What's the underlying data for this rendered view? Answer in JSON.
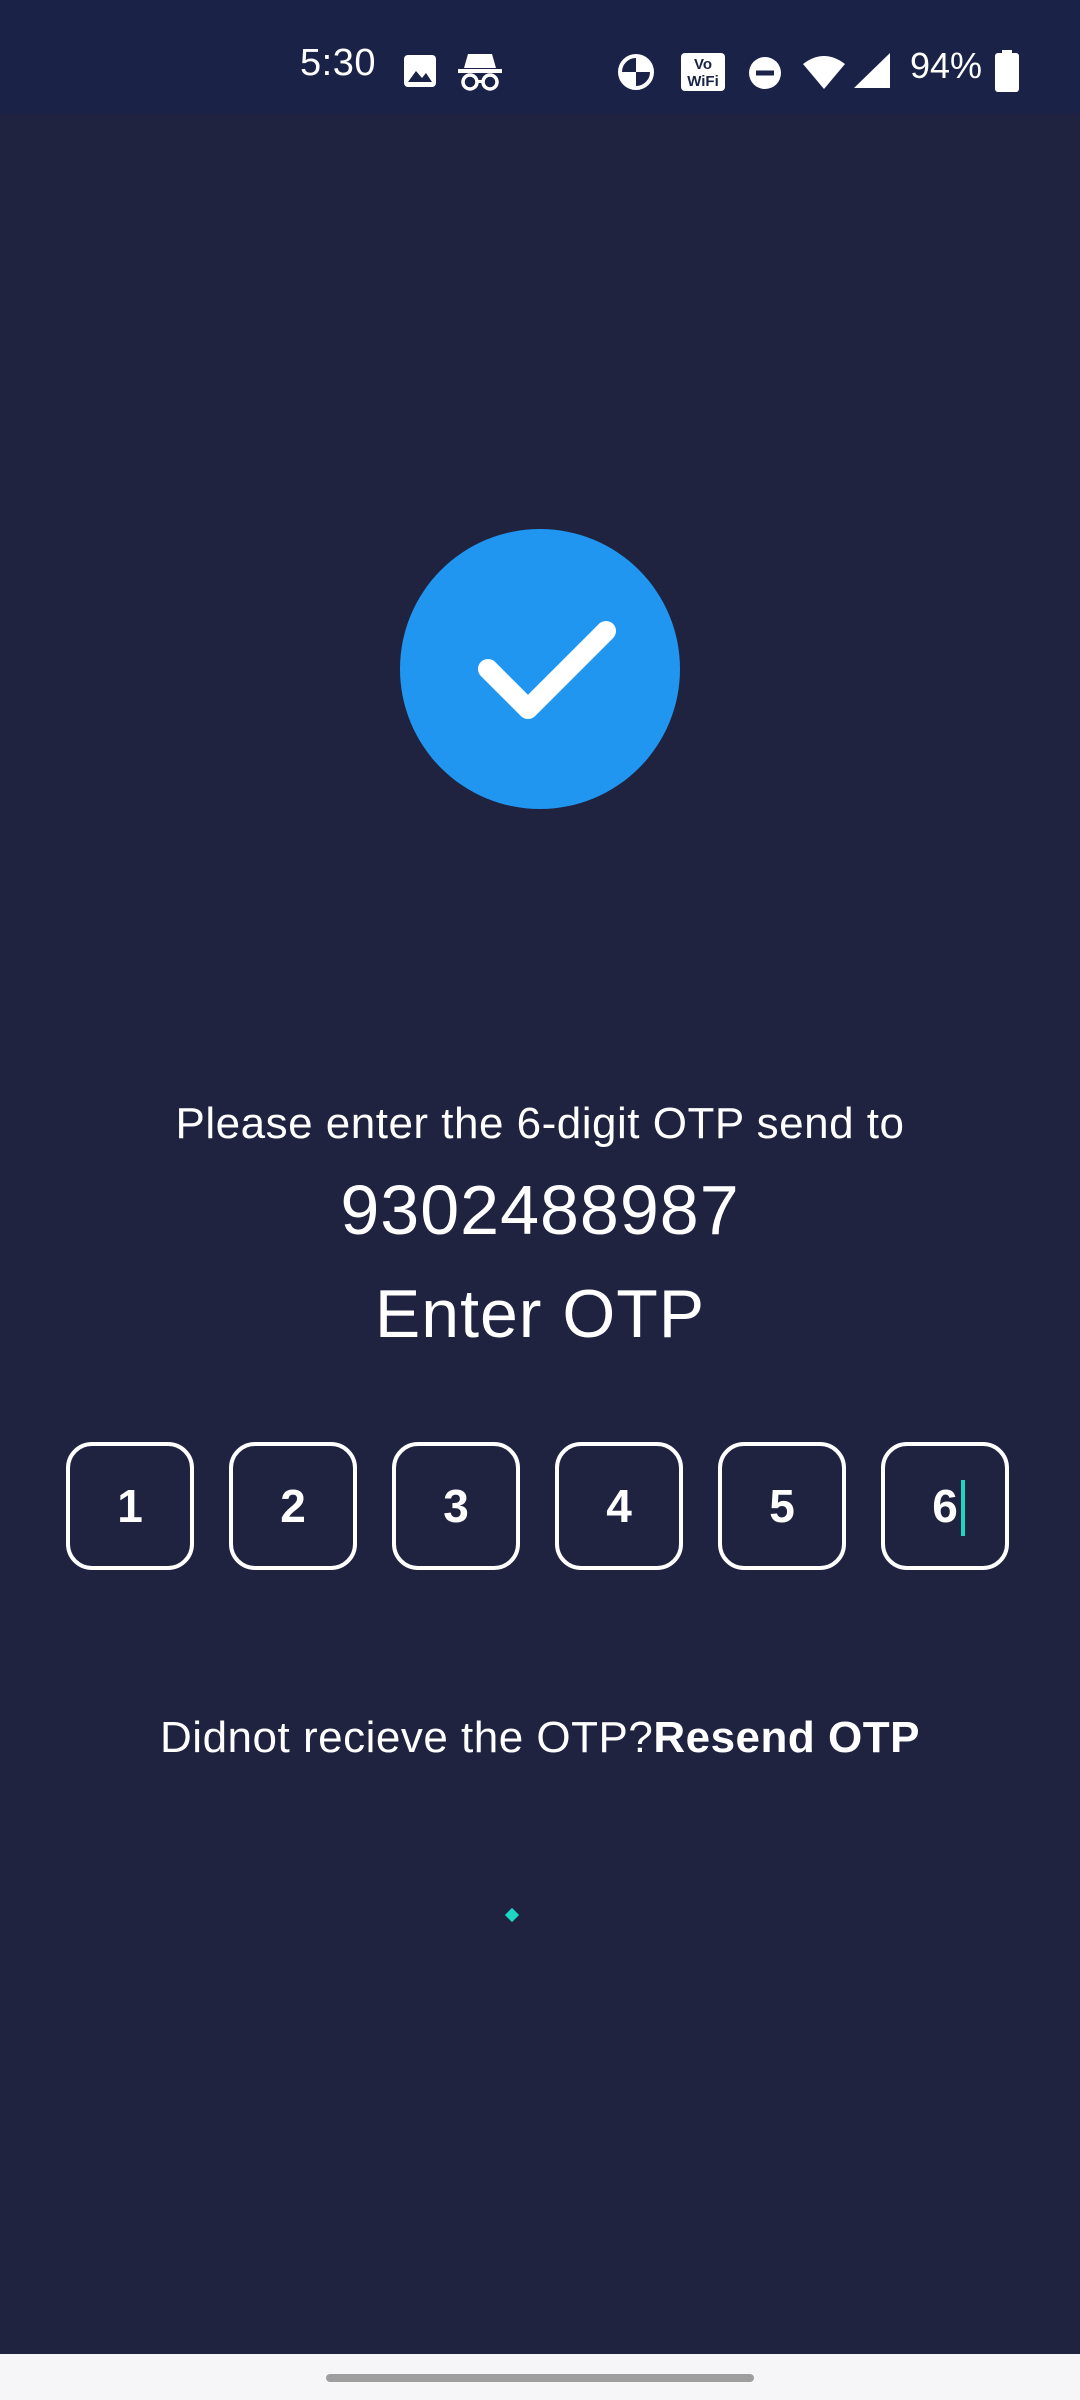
{
  "status_bar": {
    "time": "5:30",
    "battery_percent": "94%",
    "icons": [
      "image-icon",
      "incognito-icon",
      "data-saver-icon",
      "vowifi-icon",
      "dnd-icon",
      "wifi-icon",
      "signal-icon",
      "battery-icon"
    ],
    "vowifi_top": "Vo",
    "vowifi_bottom": "WiFi"
  },
  "verification": {
    "status_icon": "check-icon",
    "accent_color": "#2196f0",
    "prompt": "Please enter the 6-digit OTP send to",
    "phone_number": "9302488987",
    "title": "Enter OTP"
  },
  "otp": {
    "digits": [
      "1",
      "2",
      "3",
      "4",
      "5",
      "6"
    ],
    "cursor_color": "#1ed6c4"
  },
  "resend": {
    "question": "Didnot recieve the OTP?",
    "link_label": "Resend OTP"
  },
  "colors": {
    "background": "#1f2340",
    "status_bar": "#1b2247"
  }
}
